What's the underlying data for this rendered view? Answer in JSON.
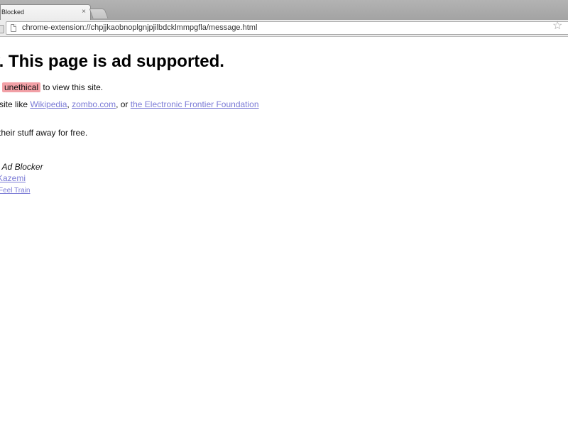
{
  "browser": {
    "tab": {
      "title": "Blocked",
      "close_glyph": "×"
    },
    "omnibox": {
      "url": "chrome-extension://chpjjkaobnoplgnjpjilbdcklmmpgfla/message.html"
    }
  },
  "page": {
    "headline": "v. This page is ad supported.",
    "line1": {
      "highlight": "unethical",
      "rest": " to view this site."
    },
    "line2": {
      "prefix": "site like ",
      "links": [
        "Wikipedia",
        "zombo.com",
        "the Electronic Frontier Foundation"
      ],
      "sep1": ", ",
      "sep2": ", or "
    },
    "line3": "their stuff away for free.",
    "signature": {
      "product": "l Ad Blocker",
      "author": "Kazemi",
      "footer": "Feel Train"
    }
  },
  "colors": {
    "highlight": "#f2a0a6",
    "link": "#7b7bd6"
  },
  "icons": [
    "page-icon",
    "star-icon",
    "close-icon",
    "new-tab-icon"
  ]
}
